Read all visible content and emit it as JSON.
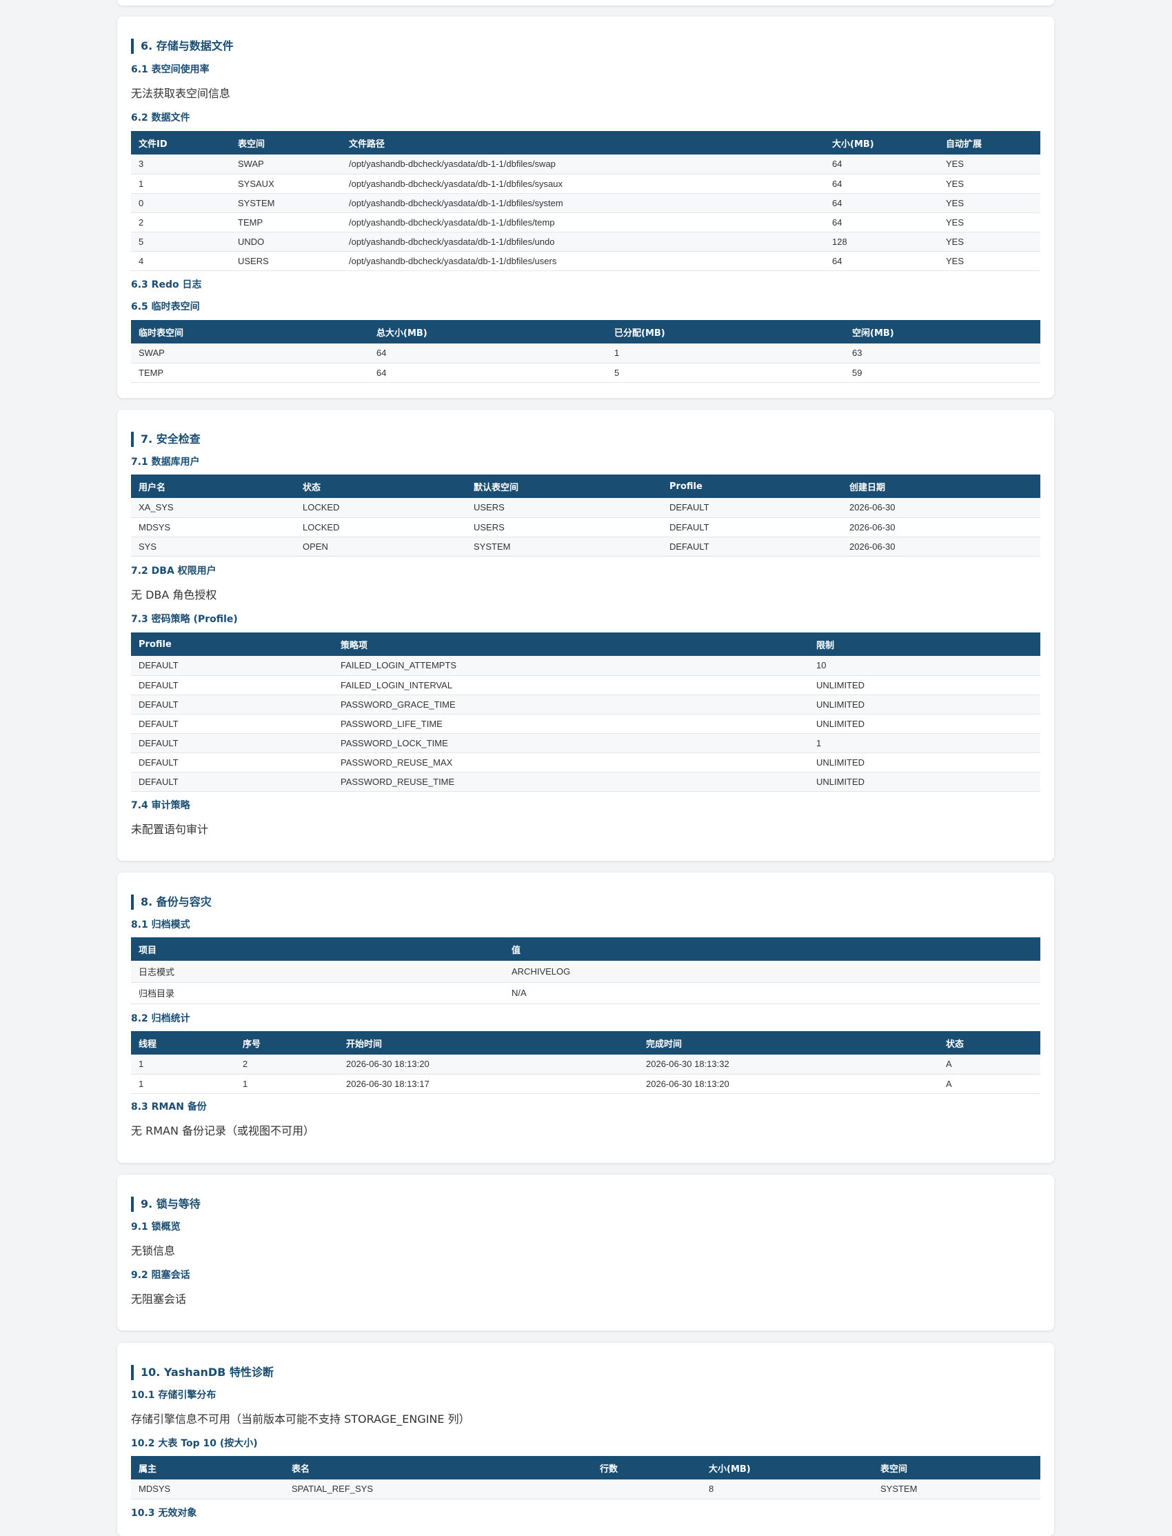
{
  "s6": {
    "title": "6. 存储与数据文件",
    "t61": "6.1 表空间使用率",
    "p61": "无法获取表空间信息",
    "t62": "6.2 数据文件",
    "datafiles": {
      "headers": [
        "文件ID",
        "表空间",
        "文件路径",
        "大小(MB)",
        "自动扩展"
      ],
      "rows": [
        [
          "3",
          "SWAP",
          "/opt/yashandb-dbcheck/yasdata/db-1-1/dbfiles/swap",
          "64",
          "YES"
        ],
        [
          "1",
          "SYSAUX",
          "/opt/yashandb-dbcheck/yasdata/db-1-1/dbfiles/sysaux",
          "64",
          "YES"
        ],
        [
          "0",
          "SYSTEM",
          "/opt/yashandb-dbcheck/yasdata/db-1-1/dbfiles/system",
          "64",
          "YES"
        ],
        [
          "2",
          "TEMP",
          "/opt/yashandb-dbcheck/yasdata/db-1-1/dbfiles/temp",
          "64",
          "YES"
        ],
        [
          "5",
          "UNDO",
          "/opt/yashandb-dbcheck/yasdata/db-1-1/dbfiles/undo",
          "128",
          "YES"
        ],
        [
          "4",
          "USERS",
          "/opt/yashandb-dbcheck/yasdata/db-1-1/dbfiles/users",
          "64",
          "YES"
        ]
      ]
    },
    "t63": "6.3 Redo 日志",
    "t65": "6.5 临时表空间",
    "temp": {
      "headers": [
        "临时表空间",
        "总大小(MB)",
        "已分配(MB)",
        "空闲(MB)"
      ],
      "rows": [
        [
          "SWAP",
          "64",
          "1",
          "63"
        ],
        [
          "TEMP",
          "64",
          "5",
          "59"
        ]
      ]
    }
  },
  "s7": {
    "title": "7. 安全检查",
    "t71": "7.1 数据库用户",
    "users": {
      "headers": [
        "用户名",
        "状态",
        "默认表空间",
        "Profile",
        "创建日期"
      ],
      "rows": [
        [
          "XA_SYS",
          "LOCKED",
          "USERS",
          "DEFAULT",
          "2026-06-30"
        ],
        [
          "MDSYS",
          "LOCKED",
          "USERS",
          "DEFAULT",
          "2026-06-30"
        ],
        [
          "SYS",
          "OPEN",
          "SYSTEM",
          "DEFAULT",
          "2026-06-30"
        ]
      ]
    },
    "t72": "7.2 DBA 权限用户",
    "p72": "无 DBA 角色授权",
    "t73": "7.3 密码策略 (Profile)",
    "profile": {
      "headers": [
        "Profile",
        "策略项",
        "限制"
      ],
      "rows": [
        [
          "DEFAULT",
          "FAILED_LOGIN_ATTEMPTS",
          "10"
        ],
        [
          "DEFAULT",
          "FAILED_LOGIN_INTERVAL",
          "UNLIMITED"
        ],
        [
          "DEFAULT",
          "PASSWORD_GRACE_TIME",
          "UNLIMITED"
        ],
        [
          "DEFAULT",
          "PASSWORD_LIFE_TIME",
          "UNLIMITED"
        ],
        [
          "DEFAULT",
          "PASSWORD_LOCK_TIME",
          "1"
        ],
        [
          "DEFAULT",
          "PASSWORD_REUSE_MAX",
          "UNLIMITED"
        ],
        [
          "DEFAULT",
          "PASSWORD_REUSE_TIME",
          "UNLIMITED"
        ]
      ]
    },
    "t74": "7.4 审计策略",
    "p74": "未配置语句审计"
  },
  "s8": {
    "title": "8. 备份与容灾",
    "t81": "8.1 归档模式",
    "archmode": {
      "headers": [
        "项目",
        "值"
      ],
      "rows": [
        [
          "日志模式",
          "ARCHIVELOG"
        ],
        [
          "归档目录",
          "N/A"
        ]
      ]
    },
    "t82": "8.2 归档统计",
    "archstat": {
      "headers": [
        "线程",
        "序号",
        "开始时间",
        "完成时间",
        "状态"
      ],
      "rows": [
        [
          "1",
          "2",
          "2026-06-30 18:13:20",
          "2026-06-30 18:13:32",
          "A"
        ],
        [
          "1",
          "1",
          "2026-06-30 18:13:17",
          "2026-06-30 18:13:20",
          "A"
        ]
      ]
    },
    "t83": "8.3 RMAN 备份",
    "p83": "无 RMAN 备份记录（或视图不可用）"
  },
  "s9": {
    "title": "9. 锁与等待",
    "t91": "9.1 锁概览",
    "p91": "无锁信息",
    "t92": "9.2 阻塞会话",
    "p92": "无阻塞会话"
  },
  "s10": {
    "title": "10. YashanDB 特性诊断",
    "t101": "10.1 存储引擎分布",
    "p101": "存储引擎信息不可用（当前版本可能不支持 STORAGE_ENGINE 列）",
    "t102": "10.2 大表 Top 10 (按大小)",
    "bigtables": {
      "headers": [
        "属主",
        "表名",
        "行数",
        "大小(MB)",
        "表空间"
      ],
      "rows": [
        [
          "MDSYS",
          "SPATIAL_REF_SYS",
          "",
          "8",
          "SYSTEM"
        ]
      ]
    },
    "t103": "10.3 无效对象"
  }
}
